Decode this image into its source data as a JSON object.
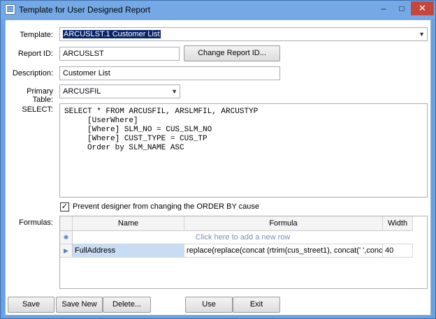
{
  "window": {
    "title": "Template for User Designed Report",
    "minimize": "–",
    "maximize": "□",
    "close": "✕"
  },
  "form": {
    "template_label": "Template:",
    "template_value": "ARCUSLST.1 Customer List",
    "report_id_label": "Report ID:",
    "report_id_value": "ARCUSLST",
    "change_report_id_button": "Change Report ID...",
    "description_label": "Description:",
    "description_value": "Customer List",
    "primary_table_label": "Primary Table:",
    "primary_table_value": "ARCUSFIL",
    "select_label": "SELECT:",
    "select_text": "SELECT * FROM ARCUSFIL, ARSLMFIL, ARCUSTYP\n     [UserWhere]\n     [Where] SLM_NO = CUS_SLM_NO\n     [Where] CUST_TYPE = CUS_TP\n     Order by SLM_NAME ASC",
    "prevent_checkbox_checked": true,
    "prevent_checkbox_label": "Prevent designer from changing the ORDER BY cause",
    "formulas_label": "Formulas:"
  },
  "grid": {
    "columns": [
      "Name",
      "Formula",
      "Width"
    ],
    "new_row_text": "Click here to add a new row",
    "new_row_marker": "✱",
    "row_marker": "▶",
    "rows": [
      {
        "name": "FullAddress",
        "formula": "replace(replace(concat (rtrim(cus_street1), concat(' ',concat(rt...",
        "width": "40"
      }
    ]
  },
  "buttons": {
    "save": "Save",
    "save_new": "Save New",
    "delete": "Delete...",
    "use": "Use",
    "exit": "Exit"
  }
}
